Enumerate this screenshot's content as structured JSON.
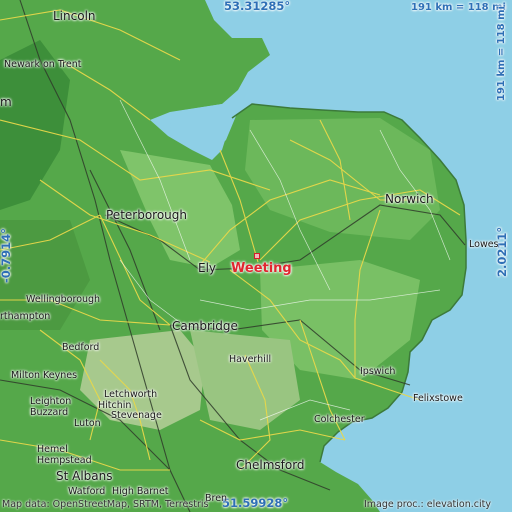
{
  "coords": {
    "north": "53.31285°",
    "south": "51.59928°",
    "west": "-0.7914°",
    "east": "2.0211°",
    "scale_top": "191 km = 118 mi",
    "scale_right": "191 km = 118 mi"
  },
  "marker": {
    "name": "Weeting"
  },
  "places": {
    "lincoln": "Lincoln",
    "newark": "Newark on Trent",
    "peterborough": "Peterborough",
    "ely": "Ely",
    "cambridge": "Cambridge",
    "norwich": "Norwich",
    "lowestoft": "Lowes",
    "haverhill": "Haverhill",
    "ipswich": "Ipswich",
    "felixstowe": "Felixstowe",
    "colchester": "Colchester",
    "chelmsford": "Chelmsford",
    "wellingborough": "Wellingborough",
    "northampton": "rthampton",
    "bedford": "Bedford",
    "miltonkeynes": "Milton Keynes",
    "letchworth": "Letchworth",
    "hitchin": "Hitchin",
    "stevenage": "Stevenage",
    "leighton": "Leighton",
    "buzzard": "Buzzard",
    "luton": "Luton",
    "hemel": "Hemel",
    "hempstead": "Hempstead",
    "stalbans": "St Albans",
    "watford": "Watford",
    "highbarnet": "High Barnet",
    "mansfield": "m",
    "brentwood": "Bren"
  },
  "credits": {
    "left": "Map data: OpenStreetMap, SRTM, Terrestris",
    "right": "Image proc.: elevation.city"
  }
}
